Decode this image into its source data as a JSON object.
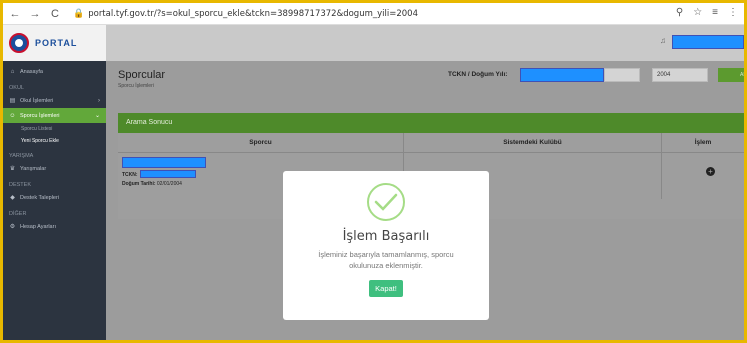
{
  "browser": {
    "url": "portal.tyf.gov.tr/?s=okul_sporcu_ekle&tckn=38998717372&dogum_yili=2004"
  },
  "brand": {
    "logo_text": "PORTAL"
  },
  "sidebar": {
    "home": "Anasayfa",
    "section_okul": "OKUL",
    "okul_islemleri": "Okul İşlemleri",
    "sporcu_islemleri": "Sporcu İşlemleri",
    "sporcu_listesi": "Sporcu Listesi",
    "yeni_sporcu_ekle": "Yeni Sporcu Ekle",
    "section_yarisma": "YARIŞMA",
    "yarismalar": "Yarışmalar",
    "section_destek": "DESTEK",
    "destek_talepleri": "Destek Talepleri",
    "section_diger": "DİĞER",
    "hesap_ayarlari": "Hesap Ayarları"
  },
  "page": {
    "title": "Sporcular",
    "subtitle": "Sporcu İşlemleri"
  },
  "search": {
    "label": "TCKN / Doğum Yılı:",
    "year_value": "2004",
    "button_label": "ARA"
  },
  "results": {
    "header": "Arama Sonucu",
    "columns": [
      "Sporcu",
      "Sistemdeki Kulübü",
      "İşlem"
    ],
    "row": {
      "tckn_label": "TCKN:",
      "birth_label": "Doğum Tarihi:",
      "birth_value": "02/01/2004"
    }
  },
  "modal": {
    "title": "İşlem Başarılı",
    "message": "İşleminiz başarıyla tamamlanmış, sporcu okulunuza eklenmiştir.",
    "button_label": "Kapat!"
  },
  "colors": {
    "accent_green": "#62a83a",
    "redaction_blue": "#1e90ff",
    "success_button": "#3fbf7f"
  }
}
